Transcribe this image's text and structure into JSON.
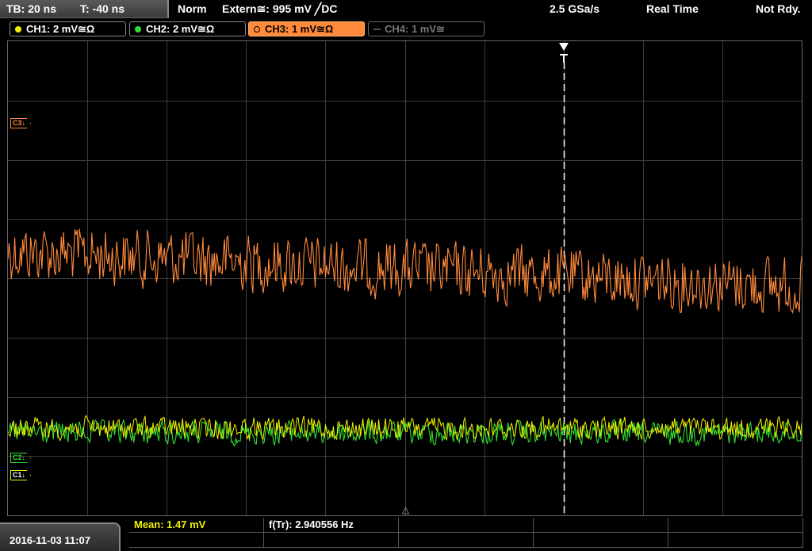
{
  "header": {
    "timebase": "TB: 20 ns",
    "trigger_offset": "T: -40 ns",
    "trigger_mode": "Norm",
    "trigger_source": "Extern≅: 995 mV ╱DC",
    "sample_rate": "2.5 GSa/s",
    "acq_mode": "Real Time",
    "status": "Not Rdy."
  },
  "channels": [
    {
      "label": "CH1: 2 mV≅Ω",
      "color": "#f0f000",
      "active": true
    },
    {
      "label": "CH2: 2 mV≅Ω",
      "color": "#33dd33",
      "active": true
    },
    {
      "label": "CH3: 1 mV≅Ω",
      "color": "#ff8a3c",
      "active": true,
      "selected": true
    },
    {
      "label": "CH4: 1 mV≅",
      "color": "#666666",
      "active": false
    }
  ],
  "markers": {
    "c3": "C3↓",
    "c2": "C2↓",
    "c1": "C1↓",
    "trigger": "T"
  },
  "measurements": {
    "mean": "Mean: 1.47 mV",
    "freq": "f(Tr): 2.940556 Hz"
  },
  "datetime": "2016-11-03 11:07",
  "colors": {
    "ch1": "#f0f000",
    "ch2": "#33dd33",
    "ch3": "#ff8a3c",
    "grid": "#3c3c3c"
  }
}
